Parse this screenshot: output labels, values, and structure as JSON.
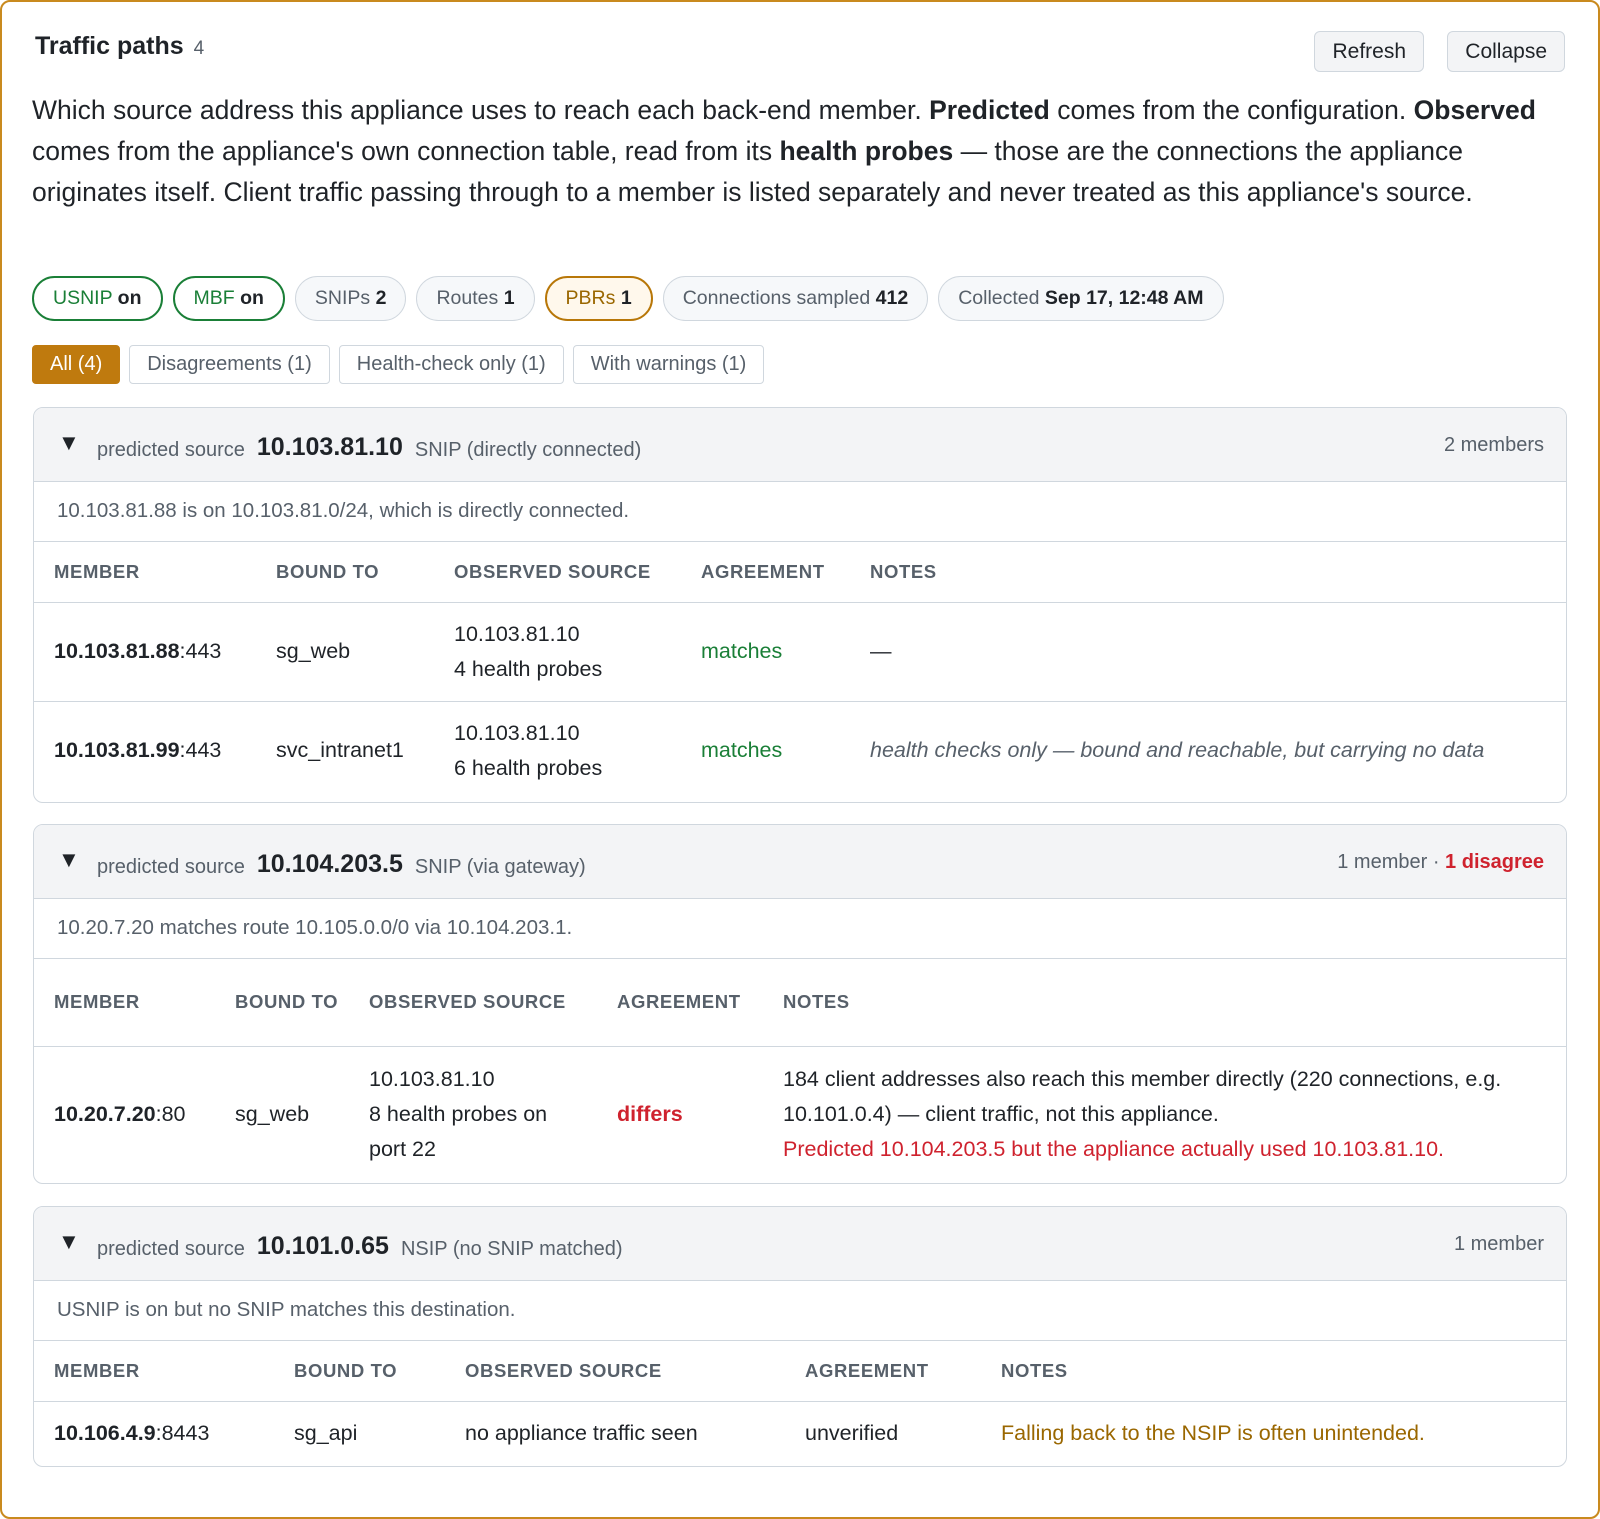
{
  "header": {
    "title": "Traffic paths",
    "count": "4",
    "refresh_label": "Refresh",
    "collapse_label": "Collapse"
  },
  "description": {
    "p1": "Which source address this appliance uses to reach each back-end member. ",
    "b1": "Predicted",
    "p2": " comes from the configuration. ",
    "b2": "Observed",
    "p3": " comes from the appliance's own connection table, read from its ",
    "b3": "health probes",
    "p4": " — those are the connections the appliance originates itself. Client traffic passing through to a member is listed separately and never treated as this appliance's source."
  },
  "chips": [
    {
      "label": "USNIP",
      "value": "on"
    },
    {
      "label": "MBF",
      "value": "on"
    },
    {
      "label": "SNIPs",
      "value": "2"
    },
    {
      "label": "Routes",
      "value": "1"
    },
    {
      "label": "PBRs",
      "value": "1"
    },
    {
      "label": "Connections sampled",
      "value": "412"
    },
    {
      "label": "Collected",
      "value": "Sep 17, 12:48 AM"
    }
  ],
  "filters": [
    {
      "label": "All (4)",
      "active": true
    },
    {
      "label": "Disagreements (1)"
    },
    {
      "label": "Health-check only (1)"
    },
    {
      "label": "With warnings (1)"
    }
  ],
  "columns": {
    "member": "MEMBER",
    "bound_to": "BOUND TO",
    "observed": "OBSERVED SOURCE",
    "agreement": "AGREEMENT",
    "notes": "NOTES"
  },
  "groups": [
    {
      "toggle": "▼",
      "lead": "predicted source",
      "ip": "10.103.81.10",
      "kind": "SNIP (directly connected)",
      "summary": "2 members",
      "note": "10.103.81.88 is on 10.103.81.0/24, which is directly connected.",
      "rows": [
        {
          "member_ip": "10.103.81.88",
          "member_port": ":443",
          "bound": "sg_web",
          "obs1": "10.103.81.10",
          "obs2": "4 health probes",
          "agreement": "matches",
          "notes": "—"
        },
        {
          "member_ip": "10.103.81.99",
          "member_port": ":443",
          "bound": "svc_intranet1",
          "obs1": "10.103.81.10",
          "obs2": "6 health probes",
          "agreement": "matches",
          "notes": "health checks only — bound and reachable, but carrying no data"
        }
      ]
    },
    {
      "toggle": "▼",
      "lead": "predicted source",
      "ip": "10.104.203.5",
      "kind": "SNIP (via gateway)",
      "summary": "1 member",
      "summary_sep": " · ",
      "summary_bad": "1 disagree",
      "note": "10.20.7.20 matches route 10.105.0.0/0 via 10.104.203.1.",
      "rows": [
        {
          "member_ip": "10.20.7.20",
          "member_port": ":80",
          "bound": "sg_web",
          "obs1": "10.103.81.10",
          "obs2": "8 health probes on port 22",
          "agreement": "differs",
          "notes": "184 client addresses also reach this member directly (220 connections, e.g. 10.101.0.4) — client traffic, not this appliance.",
          "notes_warn": "Predicted 10.104.203.5 but the appliance actually used 10.103.81.10."
        }
      ]
    },
    {
      "toggle": "▼",
      "lead": "predicted source",
      "ip": "10.101.0.65",
      "kind": "NSIP (no SNIP matched)",
      "summary": "1 member",
      "note": "USNIP is on but no SNIP matches this destination.",
      "rows": [
        {
          "member_ip": "10.106.4.9",
          "member_port": ":8443",
          "bound": "sg_api",
          "obs1": "no appliance traffic seen",
          "agreement": "unverified",
          "notes": "Falling back to the NSIP is often unintended."
        }
      ]
    }
  ],
  "colors": {
    "accent": "#bf7a0e",
    "ok": "#1a7f37",
    "bad": "#cf222e",
    "warn": "#9a6700"
  }
}
